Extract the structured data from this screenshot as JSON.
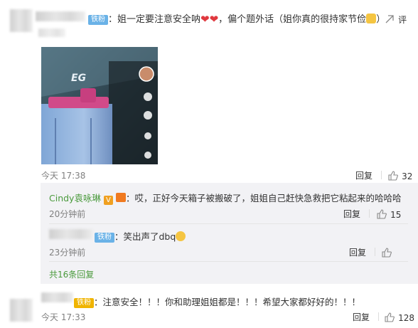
{
  "comment1": {
    "badge": "铁粉",
    "text_a": "：姐一定要注意安全呐",
    "text_b": "，偏个题外话（姐你真的很持家节俭",
    "text_c": "）",
    "comment_icon_label": "评",
    "time": "今天 17:38",
    "reply_label": "回复",
    "like_count": "32",
    "image_logo": "EG"
  },
  "replies": [
    {
      "name": "Cindy袁咏琳",
      "vip": "V",
      "text": "：哎，正好今天箱子被搬破了，姐姐自己赶快急救把它粘起来的哈哈哈",
      "time": "20分钟前",
      "reply_label": "回复",
      "like_count": "15"
    },
    {
      "badge": "铁粉",
      "text": "：笑出声了dbq",
      "time": "23分钟前",
      "reply_label": "回复",
      "like_count": ""
    }
  ],
  "more_replies": "共16条回复",
  "comment2": {
    "badge": "铁粉",
    "text": "：注意安全！！！你和助理姐姐都是！！！希望大家都好好的！！！",
    "time": "今天 17:33",
    "reply_label": "回复",
    "like_count": "128"
  },
  "colors": {
    "accent_green": "#4a9a3c",
    "badge_blue": "#6ab2e7",
    "heart_red": "#e0383e",
    "link_orange": "#eb7350"
  }
}
